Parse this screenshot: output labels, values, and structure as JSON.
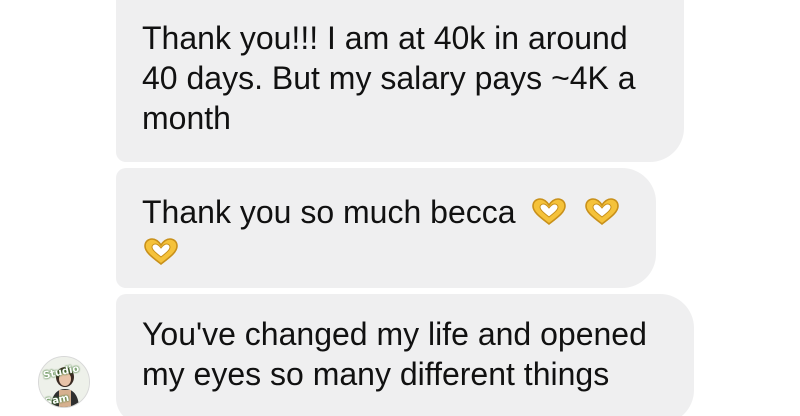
{
  "messages": [
    {
      "lines": [
        "Thank you!!! I am at 40k in around",
        "40 days. But my salary pays ~4K a",
        "month"
      ]
    },
    {
      "lines": [
        "Thank you so much becca"
      ],
      "emoji": "heart-hands-emoji"
    },
    {
      "lines": [
        "You've changed my life and opened",
        "my eyes so many different things"
      ]
    }
  ],
  "avatar": {
    "label_top": "Studio",
    "label_bottom": "Sam",
    "accent_color": "#6aa84f"
  },
  "colors": {
    "bubble": "#efeff0",
    "text": "#111111",
    "background": "#ffffff"
  }
}
